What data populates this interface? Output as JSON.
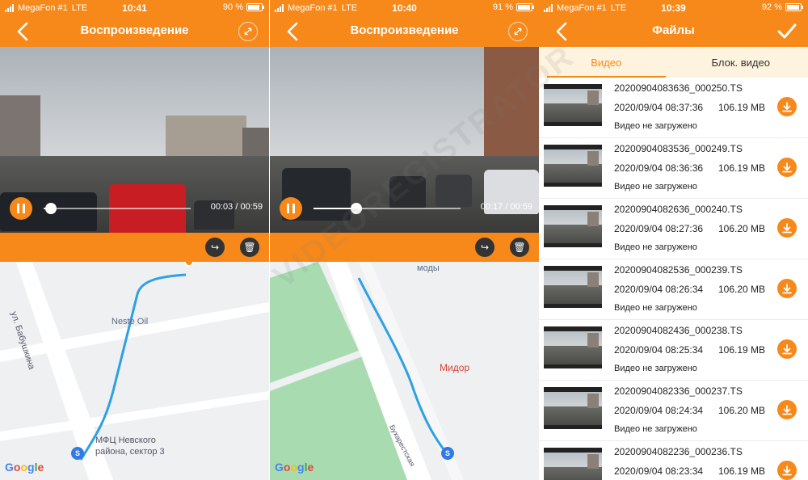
{
  "colors": {
    "accent": "#f7891b",
    "tab_bg": "#fdf3de",
    "route": "#2ea0e6"
  },
  "screens": [
    {
      "status": {
        "carrier": "MegaFon #1",
        "network": "LTE",
        "time": "10:41",
        "battery": "90 %",
        "battery_level": 0.9
      },
      "nav": {
        "title": "Воспроизведение"
      },
      "player": {
        "timecode": "00:03 / 00:59",
        "progress": 0.05
      },
      "map": {
        "labels": [
          "ул. Бабушкина",
          "Neste Oil",
          "МФЦ Невского района, сектор 3"
        ],
        "logo": "Google"
      }
    },
    {
      "status": {
        "carrier": "MegaFon #1",
        "network": "LTE",
        "time": "10:40",
        "battery": "91 %",
        "battery_level": 0.91
      },
      "nav": {
        "title": "Воспроизведение"
      },
      "player": {
        "timecode": "00:17 / 00:59",
        "progress": 0.29
      },
      "map": {
        "labels": [
          "моды",
          "Мидор",
          "Бухарестская"
        ],
        "logo": "Google"
      }
    },
    {
      "status": {
        "carrier": "MegaFon #1",
        "network": "LTE",
        "time": "10:39",
        "battery": "92 %",
        "battery_level": 0.92
      },
      "nav": {
        "title": "Файлы"
      },
      "tabs": [
        "Видео",
        "Блок. видео"
      ],
      "files": [
        {
          "name": "20200904083636_000250.TS",
          "date": "2020/09/04 08:37:36",
          "size": "106.19 MB",
          "status": "Видео не загружено"
        },
        {
          "name": "20200904083536_000249.TS",
          "date": "2020/09/04 08:36:36",
          "size": "106.19 MB",
          "status": "Видео не загружено"
        },
        {
          "name": "20200904082636_000240.TS",
          "date": "2020/09/04 08:27:36",
          "size": "106.20 MB",
          "status": "Видео не загружено"
        },
        {
          "name": "20200904082536_000239.TS",
          "date": "2020/09/04 08:26:34",
          "size": "106.20 MB",
          "status": "Видео не загружено"
        },
        {
          "name": "20200904082436_000238.TS",
          "date": "2020/09/04 08:25:34",
          "size": "106.19 MB",
          "status": "Видео не загружено"
        },
        {
          "name": "20200904082336_000237.TS",
          "date": "2020/09/04 08:24:34",
          "size": "106.20 MB",
          "status": "Видео не загружено"
        },
        {
          "name": "20200904082236_000236.TS",
          "date": "2020/09/04 08:23:34",
          "size": "106.19 MB",
          "status": ""
        }
      ]
    }
  ],
  "watermark": "VIDEOREGISTRATOR",
  "icons": [
    "back-arrow-icon",
    "expand-icon",
    "pause-icon",
    "share-icon",
    "trash-icon",
    "check-icon",
    "download-icon"
  ]
}
